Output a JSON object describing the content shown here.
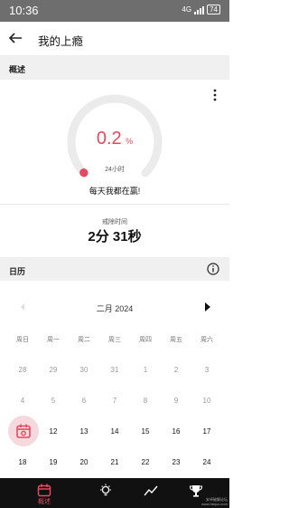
{
  "status_bar": {
    "time": "10:36",
    "network": "4G",
    "battery": "74"
  },
  "app_bar": {
    "title": "我的上瘾"
  },
  "overview": {
    "section_label": "概述",
    "percent_value": "0.2",
    "percent_unit": "%",
    "percent_progress": 0.002,
    "period": "24小时",
    "motto": "每天我都在赢!",
    "quit_time_label": "戒除时间",
    "quit_time_value": "2分 31秒"
  },
  "calendar": {
    "section_label": "日历",
    "month": "二月 2024",
    "weekdays": [
      "周日",
      "周一",
      "周二",
      "周三",
      "周四",
      "周五",
      "周六"
    ],
    "rows": [
      [
        "28",
        "29",
        "30",
        "31",
        "1",
        "2",
        "3"
      ],
      [
        "4",
        "5",
        "6",
        "7",
        "8",
        "9",
        "10"
      ],
      [
        "",
        "12",
        "13",
        "14",
        "15",
        "16",
        "17"
      ],
      [
        "18",
        "19",
        "20",
        "21",
        "22",
        "23",
        "24"
      ]
    ]
  },
  "bottom_nav": {
    "overview_label": "概述"
  },
  "watermark": {
    "line1": "安卓破解论坛",
    "line2": "www.hbqcc.com"
  },
  "colors": {
    "accent": "#e24a62",
    "section_bg": "#f0f0f0",
    "status_bar": "#6e6e6e",
    "nav_bar": "#111111"
  }
}
